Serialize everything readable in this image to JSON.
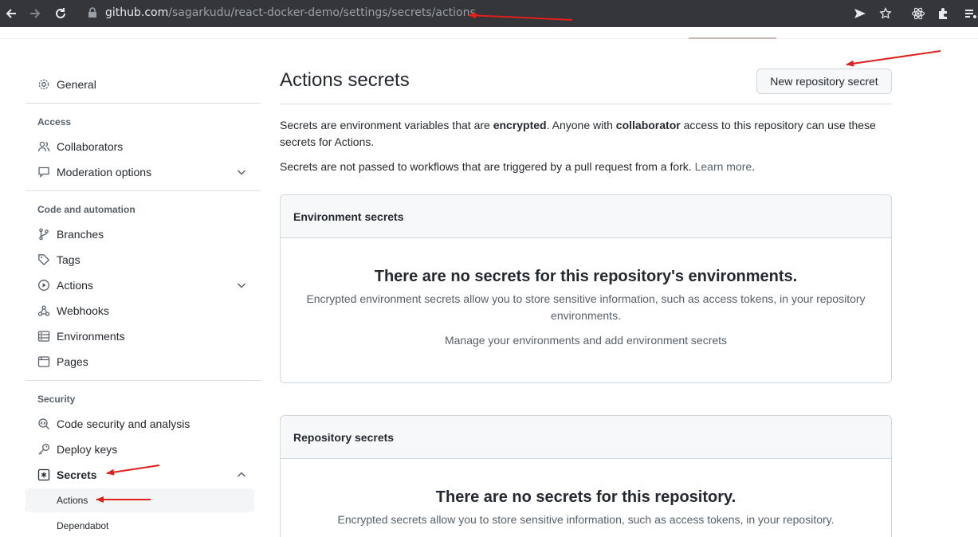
{
  "browser": {
    "url_host": "github.com",
    "url_path": "/sagarkudu/react-docker-demo/settings/secrets/actions"
  },
  "sidebar": {
    "general": "General",
    "access_header": "Access",
    "collaborators": "Collaborators",
    "moderation": "Moderation options",
    "code_header": "Code and automation",
    "branches": "Branches",
    "tags": "Tags",
    "actions": "Actions",
    "webhooks": "Webhooks",
    "environments": "Environments",
    "pages": "Pages",
    "security_header": "Security",
    "code_security": "Code security and analysis",
    "deploy_keys": "Deploy keys",
    "secrets": "Secrets",
    "secrets_actions": "Actions",
    "secrets_dependabot": "Dependabot"
  },
  "main": {
    "title": "Actions secrets",
    "new_button": "New repository secret",
    "intro_1": "Secrets are environment variables that are ",
    "intro_bold_1": "encrypted",
    "intro_2": ". Anyone with ",
    "intro_bold_2": "collaborator",
    "intro_3": " access to this repository can use these secrets for Actions.",
    "fork_note": "Secrets are not passed to workflows that are triggered by a pull request from a fork. ",
    "learn_more": "Learn more",
    "learn_more_end": ".",
    "env_box": {
      "header": "Environment secrets",
      "blank_title": "There are no secrets for this repository's environments.",
      "blank_text": "Encrypted environment secrets allow you to store sensitive information, such as access tokens, in your repository environments.",
      "manage_text": "Manage your environments and add environment secrets"
    },
    "repo_box": {
      "header": "Repository secrets",
      "blank_title": "There are no secrets for this repository.",
      "blank_text": "Encrypted secrets allow you to store sensitive information, such as access tokens, in your repository."
    }
  },
  "colors": {
    "annotation_red": "#e0201b",
    "browser_bar": "#35363a"
  }
}
